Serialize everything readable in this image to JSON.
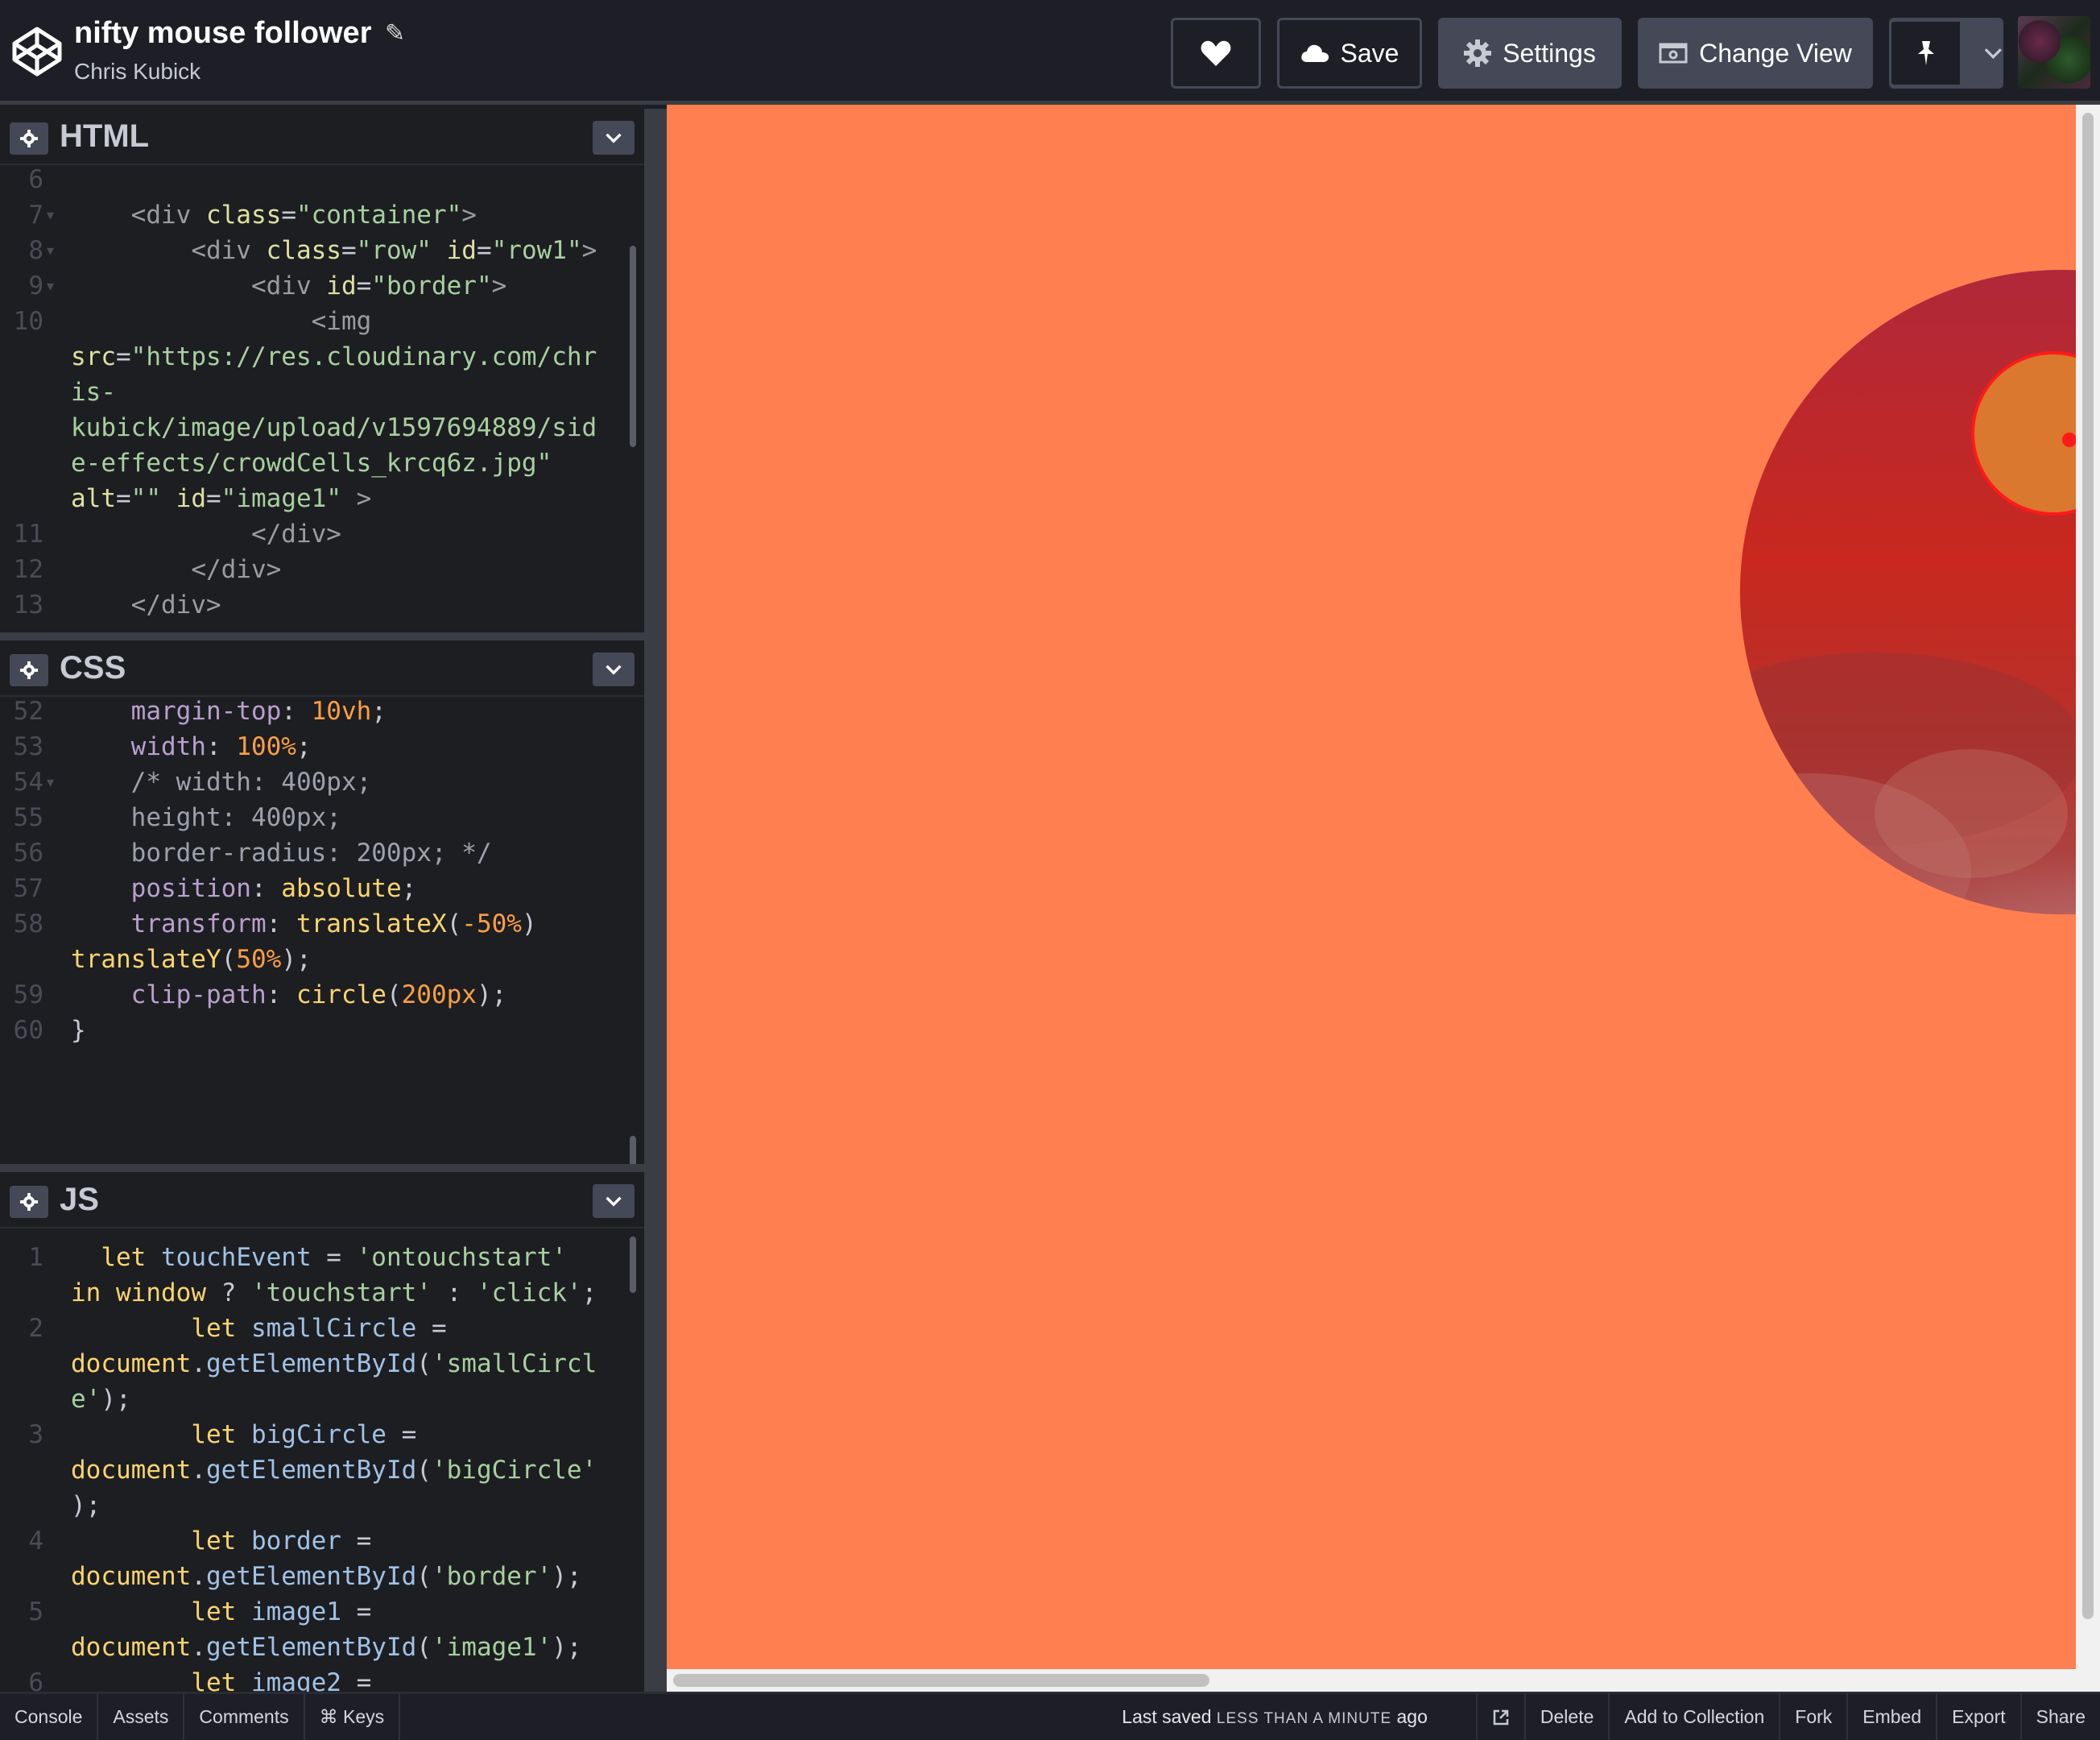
{
  "header": {
    "title": "nifty mouse follower",
    "author": "Chris Kubick",
    "buttons": {
      "save": "Save",
      "settings": "Settings",
      "change_view": "Change View"
    }
  },
  "panels": {
    "html": {
      "title": "HTML",
      "lines": [
        {
          "n": "6",
          "fold": false,
          "html": ""
        },
        {
          "n": "7",
          "fold": true,
          "html": "    <span class='tg'>&lt;div</span> <span class='at'>class</span>=<span class='st'>\"container\"</span><span class='tg'>&gt;</span>"
        },
        {
          "n": "8",
          "fold": true,
          "html": "        <span class='tg'>&lt;div</span> <span class='at'>class</span>=<span class='st'>\"row\"</span> <span class='at'>id</span>=<span class='st'>\"row1\"</span><span class='tg'>&gt;</span>"
        },
        {
          "n": "9",
          "fold": true,
          "html": "            <span class='tg'>&lt;div</span> <span class='at'>id</span>=<span class='st'>\"border\"</span><span class='tg'>&gt;</span>"
        },
        {
          "n": "10",
          "fold": false,
          "html": "                <span class='tg'>&lt;img</span>"
        },
        {
          "n": "",
          "fold": false,
          "html": "<span class='at'>src</span>=<span class='st'>\"https://res.cloudinary.com/chr</span>"
        },
        {
          "n": "",
          "fold": false,
          "html": "<span class='st'>is-</span>"
        },
        {
          "n": "",
          "fold": false,
          "html": "<span class='st'>kubick/image/upload/v1597694889/sid</span>"
        },
        {
          "n": "",
          "fold": false,
          "html": "<span class='st'>e-effects/crowdCells_krcq6z.jpg\"</span>"
        },
        {
          "n": "",
          "fold": false,
          "html": "<span class='at'>alt</span>=<span class='st'>\"\"</span> <span class='at'>id</span>=<span class='st'>\"image1\"</span> <span class='tg'>&gt;</span>"
        },
        {
          "n": "11",
          "fold": false,
          "html": "            <span class='tg'>&lt;/div&gt;</span>"
        },
        {
          "n": "12",
          "fold": false,
          "html": "        <span class='tg'>&lt;/div&gt;</span>"
        },
        {
          "n": "13",
          "fold": false,
          "html": "    <span class='tg'>&lt;/div&gt;</span>"
        }
      ]
    },
    "css": {
      "title": "CSS",
      "lines": [
        {
          "n": "52",
          "fold": false,
          "html": "    <span class='pr'>margin-top</span>: <span class='nm'>10vh</span>;"
        },
        {
          "n": "53",
          "fold": false,
          "html": "    <span class='pr'>width</span>: <span class='nm'>100%</span>;"
        },
        {
          "n": "54",
          "fold": true,
          "html": "    <span class='cm'>/* width: 400px;</span>"
        },
        {
          "n": "55",
          "fold": false,
          "html": "    <span class='cm'>height: 400px;</span>"
        },
        {
          "n": "56",
          "fold": false,
          "html": "    <span class='cm'>border-radius: 200px; */</span>"
        },
        {
          "n": "57",
          "fold": false,
          "html": "    <span class='pr'>position</span>: <span class='vl'>absolute</span>;"
        },
        {
          "n": "58",
          "fold": false,
          "html": "    <span class='pr'>transform</span>: <span class='vl'>translateX</span>(<span class='nm'>-50%</span>)"
        },
        {
          "n": "",
          "fold": false,
          "html": "<span class='vl'>translateY</span>(<span class='nm'>50%</span>);"
        },
        {
          "n": "59",
          "fold": false,
          "html": "    <span class='pr'>clip-path</span>: <span class='vl'>circle</span>(<span class='nm'>200px</span>);"
        },
        {
          "n": "60",
          "fold": false,
          "html": "}"
        }
      ]
    },
    "js": {
      "title": "JS",
      "lines": [
        {
          "n": "1",
          "fold": false,
          "html": "  <span class='kw'>let</span> <span class='vr'>touchEvent</span> = <span class='st'>'ontouchstart'</span>"
        },
        {
          "n": "",
          "fold": false,
          "html": "<span class='kw'>in</span> <span class='kw'>window</span> ? <span class='st'>'touchstart'</span> : <span class='st'>'click'</span>;"
        },
        {
          "n": "2",
          "fold": false,
          "html": "        <span class='kw'>let</span> <span class='vr'>smallCircle</span> ="
        },
        {
          "n": "",
          "fold": false,
          "html": "<span class='kw'>document</span>.<span class='vr'>getElementById</span>(<span class='st'>'smallCircl</span>"
        },
        {
          "n": "",
          "fold": false,
          "html": "<span class='st'>e'</span>);"
        },
        {
          "n": "3",
          "fold": false,
          "html": "        <span class='kw'>let</span> <span class='vr'>bigCircle</span> ="
        },
        {
          "n": "",
          "fold": false,
          "html": "<span class='kw'>document</span>.<span class='vr'>getElementById</span>(<span class='st'>'bigCircle'</span>"
        },
        {
          "n": "",
          "fold": false,
          "html": ");"
        },
        {
          "n": "4",
          "fold": false,
          "html": "        <span class='kw'>let</span> <span class='vr'>border</span> ="
        },
        {
          "n": "",
          "fold": false,
          "html": "<span class='kw'>document</span>.<span class='vr'>getElementById</span>(<span class='st'>'border'</span>);"
        },
        {
          "n": "5",
          "fold": false,
          "html": "        <span class='kw'>let</span> <span class='vr'>image1</span> ="
        },
        {
          "n": "",
          "fold": false,
          "html": "<span class='kw'>document</span>.<span class='vr'>getElementById</span>(<span class='st'>'image1'</span>);"
        },
        {
          "n": "6",
          "fold": false,
          "html": "        <span class='kw'>let</span> <span class='vr'>image2</span> ="
        }
      ]
    }
  },
  "footer": {
    "left": [
      "Console",
      "Assets",
      "Comments",
      "⌘ Keys"
    ],
    "saved_prefix": "Last saved",
    "saved_time": "LESS THAN A MINUTE",
    "saved_suffix": "ago",
    "right": [
      "Delete",
      "Add to Collection",
      "Fork",
      "Embed",
      "Export",
      "Share"
    ]
  },
  "colors": {
    "preview_bg": "#ff7f50",
    "ui_dark": "#1e1f26",
    "button_grey": "#444857"
  },
  "icons": [
    "codepen-logo-icon",
    "pencil-icon",
    "heart-icon",
    "cloud-icon",
    "gear-icon",
    "change-view-icon",
    "pin-icon",
    "chevron-down-icon",
    "external-link-icon"
  ]
}
